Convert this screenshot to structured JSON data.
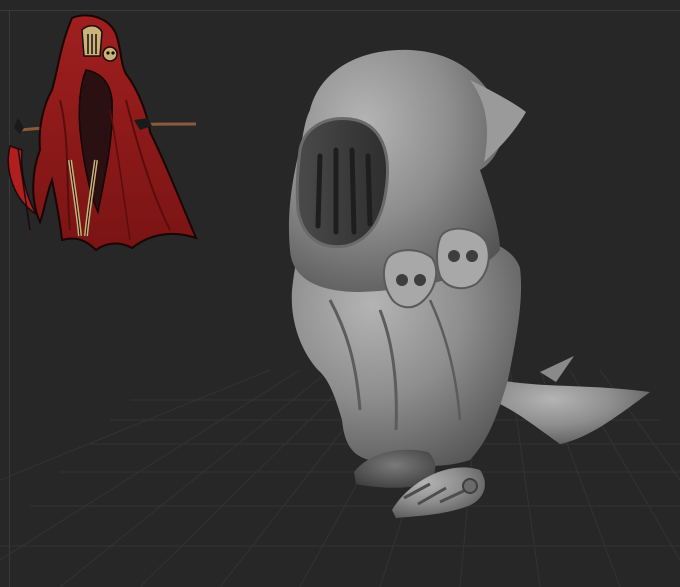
{
  "canvas": {
    "background": "#272727",
    "grid_color": "#333333"
  },
  "reference": {
    "subject": "red-cloaked-reaper-concept-art",
    "cloak_color": "#9c1c1c",
    "shadow_color": "#5a0d0d",
    "bone_color": "#c8b47a"
  },
  "model": {
    "subject": "grey-reaper-sculpt",
    "material_color": "#8a8a8a"
  }
}
